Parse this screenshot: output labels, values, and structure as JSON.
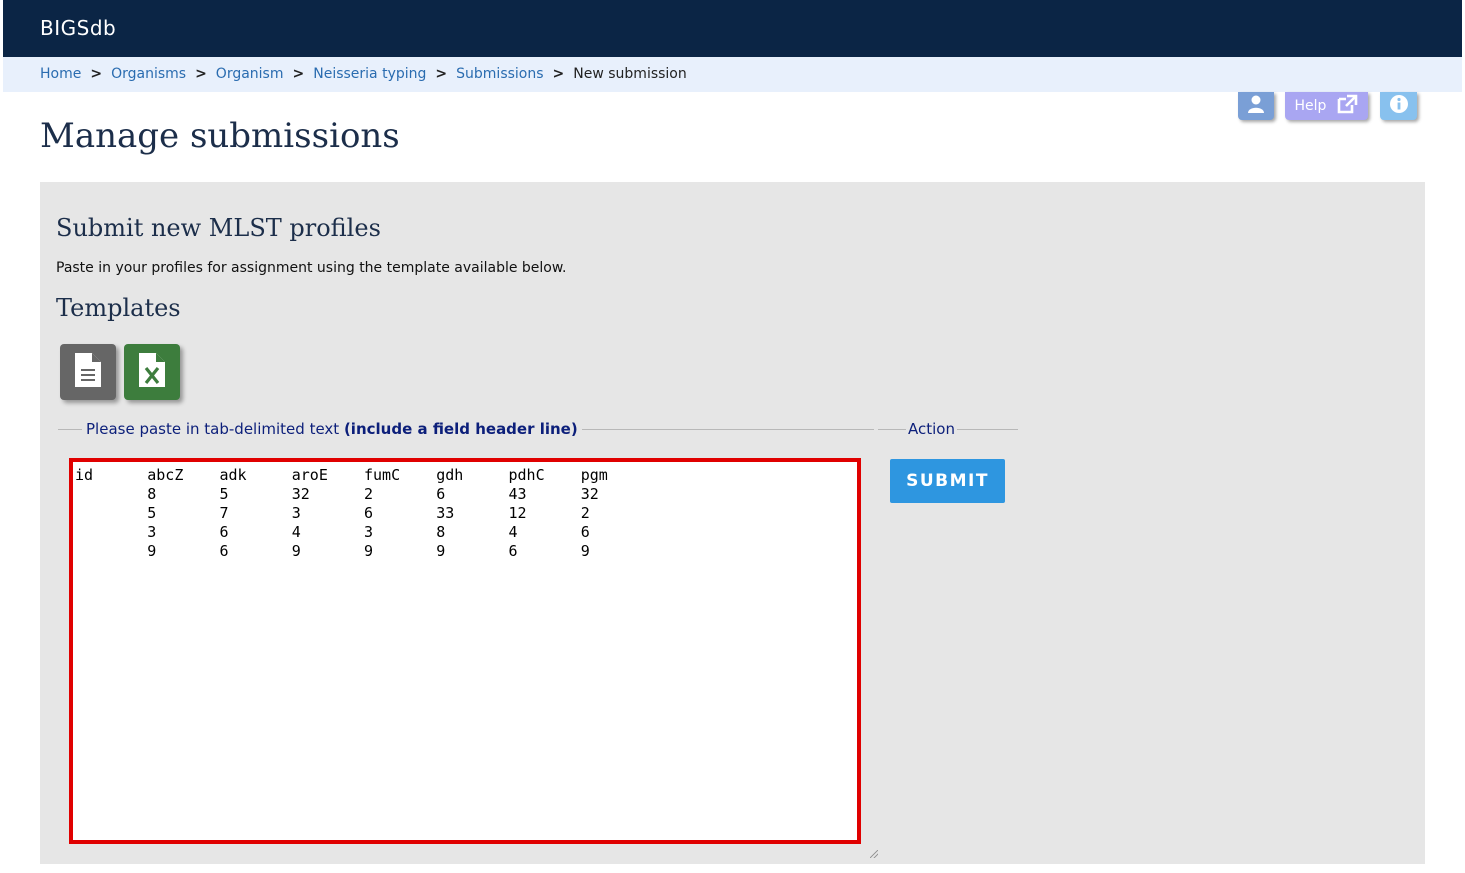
{
  "header": {
    "app_title": "BIGSdb"
  },
  "breadcrumb": {
    "items": [
      "Home",
      "Organisms",
      "Organism",
      "Neisseria typing",
      "Submissions"
    ],
    "current": "New submission",
    "separator": ">"
  },
  "toolbar": {
    "help_label": "Help"
  },
  "page": {
    "title": "Manage submissions"
  },
  "form": {
    "subtitle": "Submit new MLST profiles",
    "intro": "Paste in your profiles for assignment using the template available below.",
    "templates_title": "Templates",
    "paste_legend": "Please paste in tab-delimited text",
    "paste_legend_bold": "(include a field header line)",
    "paste_value": "id\tabcZ\tadk\taroE\tfumC\tgdh\tpdhC\tpgm\n\t8\t5\t32\t2\t6\t43\t32\n\t5\t7\t3\t6\t33\t12\t2\n\t3\t6\t4\t3\t8\t4\t6\n\t9\t6\t9\t9\t9\t6\t9",
    "action_legend": "Action",
    "submit_label": "SUBMIT"
  },
  "icons": {
    "user": "user-icon",
    "help_external": "external-link-icon",
    "info": "info-icon",
    "text_template": "text-file-icon",
    "excel_template": "excel-file-icon"
  },
  "colors": {
    "header_bg": "#0b2545",
    "breadcrumb_bg": "#e8f0fc",
    "link": "#2a6cb0",
    "panel_bg": "#e6e6e6",
    "submit_bg": "#2e96e0",
    "highlight_border": "#e00000"
  }
}
